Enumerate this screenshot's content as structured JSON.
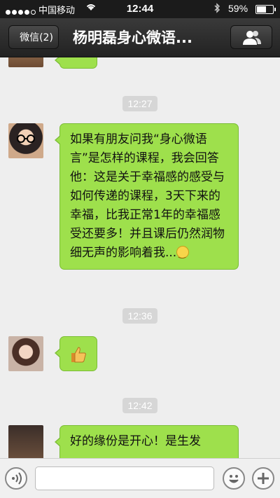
{
  "status_bar": {
    "carrier": "中国移动",
    "time": "12:44",
    "battery_percent": "59%",
    "battery_level": 0.59,
    "signal_bars": 4
  },
  "nav": {
    "back_label": "微信(2)",
    "title": "杨明磊身心微语..."
  },
  "messages": [
    {
      "timestamp": "12:27",
      "text": "如果有朋友问我“身心微语言”是怎样的课程，我会回答他：这是关于幸福感的感受与如何传递的课程，3天下来的幸福，比我正常1年的幸福感受还要多！并且课后仍然润物细无声的影响着我...",
      "emoji": "smiley-icon"
    },
    {
      "timestamp": "12:36",
      "emoji": "thumbs-up-icon"
    },
    {
      "timestamp": "12:42",
      "text": "好的缘份是开心！是生发"
    }
  ],
  "colors": {
    "bubble": "#9ee04c",
    "nav": "#2a2a2a",
    "background": "#eeeeee"
  }
}
